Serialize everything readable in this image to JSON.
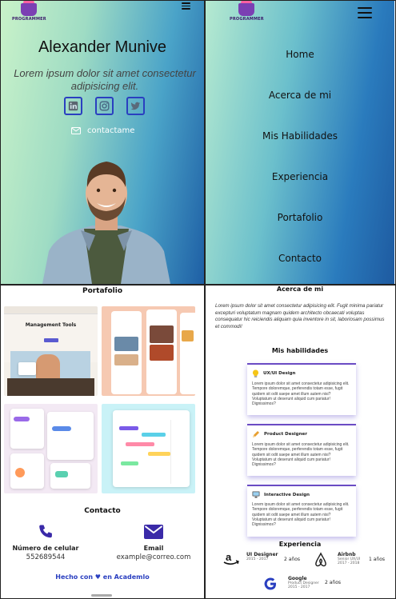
{
  "brand": {
    "logo_text": "PROGRAMMER"
  },
  "hero": {
    "name": "Alexander Munive",
    "tagline": "Lorem ipsum dolor sit amet consectetur adipisicing elit.",
    "social_icons": [
      "linkedin-icon",
      "instagram-icon",
      "twitter-icon"
    ],
    "contact_label": "contactame",
    "accent": "#2a3fc0"
  },
  "menu": {
    "items": [
      {
        "label": "Home"
      },
      {
        "label": "Acerca de mi"
      },
      {
        "label": "Mis Habilidades"
      },
      {
        "label": "Experiencia"
      },
      {
        "label": "Portafolio"
      },
      {
        "label": "Contacto"
      }
    ]
  },
  "portfolio": {
    "title": "Portafolio",
    "thumbnails": [
      {
        "caption": "Management Tools"
      },
      {
        "caption": ""
      },
      {
        "caption": ""
      },
      {
        "caption": ""
      }
    ]
  },
  "contact": {
    "title": "Contacto",
    "phone_label": "Número de celular",
    "phone_value": "552689544",
    "email_label": "Email",
    "email_value": "example@correo.com"
  },
  "footer": {
    "made_with": "Hecho con ♥ en Academlo"
  },
  "about": {
    "title": "Acerca de mi",
    "text": "Lorem ipsum dolor sit amet consectetur adipisicing elit. Fugit minima pariatur excepturi voluptatum magnam quidem architecto obcaecati voluptas consequatur hic reiciendis aliquam quia inventore in sit, laboriosam possimus et commodi!"
  },
  "skills": {
    "title": "Mis habilidades",
    "cards": [
      {
        "icon": "lightbulb-icon",
        "title": "UX/UI Design",
        "body": "Lorem ipsum dolor sit amet consectetur adipisicing elit. Tempore doloremque, perferendis totam esse, fugit quidem sit odit saepe amet illum autem nisi? Voluptatum ut deserunt aliquid cum pariatur! Dignissimos?"
      },
      {
        "icon": "pencil-icon",
        "title": "Product Designer",
        "body": "Lorem ipsum dolor sit amet consectetur adipisicing elit. Tempore doloremque, perferendis totam esse, fugit quidem sit odit saepe amet illum autem nisi? Voluptatum ut deserunt aliquid cum pariatur! Dignissimos?"
      },
      {
        "icon": "monitor-icon",
        "title": "Interactive Design",
        "body": "Lorem ipsum dolor sit amet consectetur adipisicing elit. Tempore doloremque, perferendis totam esse, fugit quidem sit odit saepe amet illum autem nisi? Voluptatum ut deserunt aliquid cum pariatur! Dignissimos?"
      }
    ]
  },
  "experience": {
    "title": "Experiencia",
    "items": [
      {
        "logo": "amazon-logo-icon",
        "role": "UI Designer",
        "dates": "2015 - 2017",
        "duration": "2 años"
      },
      {
        "logo": "airbnb-logo-icon",
        "role": "Airbnb",
        "dates": "Senior UX/UI 2017 - 2018",
        "duration": "1 años"
      },
      {
        "logo": "google-logo-icon",
        "role": "Google",
        "dates": "Product Designer 2015 - 2017",
        "duration": "2 años"
      }
    ]
  }
}
